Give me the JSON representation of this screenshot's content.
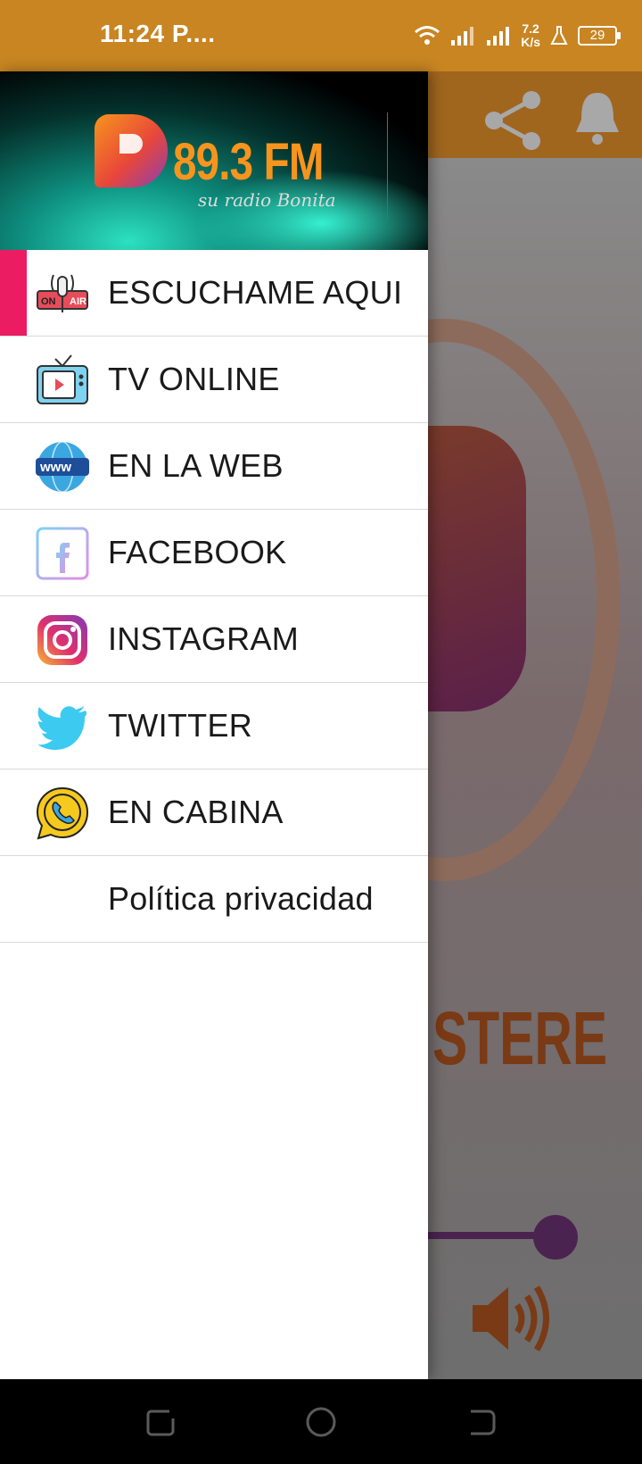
{
  "status_bar": {
    "time": "11:24 P....",
    "net_speed_value": "7.2",
    "net_speed_unit": "K/s",
    "battery": "29"
  },
  "header": {
    "logo_text": "89.3 FM",
    "logo_tagline": "su radio Bonita"
  },
  "menu": {
    "items": [
      {
        "label": "ESCUCHAME AQUI",
        "icon": "on-air-microphone-icon",
        "active": true
      },
      {
        "label": "TV ONLINE",
        "icon": "tv-icon"
      },
      {
        "label": "EN LA WEB",
        "icon": "www-globe-icon"
      },
      {
        "label": "FACEBOOK",
        "icon": "facebook-icon"
      },
      {
        "label": "INSTAGRAM",
        "icon": "instagram-icon"
      },
      {
        "label": "TWITTER",
        "icon": "twitter-icon"
      },
      {
        "label": "EN CABINA",
        "icon": "whatsapp-icon"
      },
      {
        "label": "Política privacidad",
        "icon": ""
      }
    ]
  },
  "background": {
    "stereo_text": "STERE"
  },
  "colors": {
    "status_bar": "#c88522",
    "active_indicator": "#ec1c63",
    "logo_orange": "#f7941d"
  }
}
